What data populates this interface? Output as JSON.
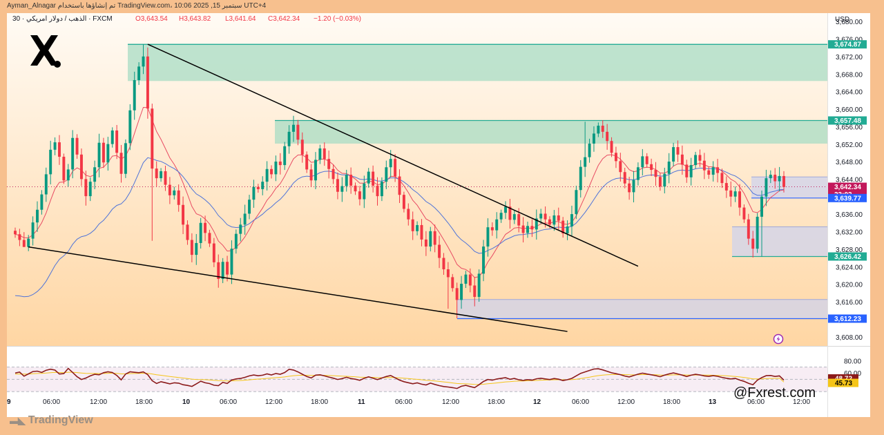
{
  "header": {
    "caption": "Ayman_Alnagar تم إنشاؤها باستخدام TradingView.com، 10:06 2025 ,15 سبتمبر UTC+4",
    "symbol": "30 · الذهب / دولار امريكي · FXCM",
    "open": "O3,643.54",
    "high": "H3,643.82",
    "low": "L3,641.64",
    "close": "C3,642.34",
    "change": "−1.20 (−0.03%)"
  },
  "brand": {
    "logo_text": "TradingView",
    "watermark": "@Fxrest.com"
  },
  "chart_data": [
    {
      "type": "candlestick",
      "symbol": "XAUUSD",
      "currency": "USD",
      "ylim": [
        3606,
        3682
      ],
      "y_ticks": [
        3608,
        3612,
        3616,
        3620,
        3624,
        3628,
        3632,
        3636,
        3640,
        3644,
        3648,
        3652,
        3656,
        3660,
        3664,
        3668,
        3672,
        3676,
        3680
      ],
      "y_tick_labels": [
        "3,608.00",
        "3,612.00",
        "3,616.00",
        "3,620.00",
        "3,624.00",
        "3,628.00",
        "3,632.00",
        "3,636.00",
        "3,640.00",
        "3,644.00",
        "3,648.00",
        "3,652.00",
        "3,656.00",
        "3,660.00",
        "3,664.00",
        "3,668.00",
        "3,672.00",
        "3,676.00",
        "3,680.00"
      ],
      "x_tick_labels": [
        "9",
        "06:00",
        "12:00",
        "18:00",
        "10",
        "06:00",
        "12:00",
        "18:00",
        "11",
        "06:00",
        "12:00",
        "18:00",
        "12",
        "06:00",
        "12:00",
        "18:00",
        "13",
        "06:00",
        "12:00"
      ],
      "price_labels": [
        {
          "text": "3,674.87",
          "value": 3674.87,
          "color": "#22ab94"
        },
        {
          "text": "3,657.48",
          "value": 3657.48,
          "color": "#22ab94"
        },
        {
          "text": "3,642.34",
          "value": 3642.34,
          "color": "#c2185b"
        },
        {
          "text": "23:02",
          "value": 3640.8,
          "color": "#c2185b"
        },
        {
          "text": "3,639.77",
          "value": 3639.77,
          "color": "#2962ff"
        },
        {
          "text": "3,626.42",
          "value": 3626.42,
          "color": "#22ab94"
        },
        {
          "text": "3,612.23",
          "value": 3612.23,
          "color": "#2962ff"
        }
      ],
      "zones": [
        {
          "kind": "supply",
          "top": 3674.87,
          "bottom": 3666.5,
          "color": "#a8dcc4"
        },
        {
          "kind": "supply",
          "top": 3657.48,
          "bottom": 3652.2,
          "color": "#a8dcc4"
        },
        {
          "kind": "range",
          "top": 3644.6,
          "bottom": 3639.77,
          "color": "#cfd3ee"
        },
        {
          "kind": "range",
          "top": 3633.2,
          "bottom": 3626.42,
          "color": "#cfd3ee"
        },
        {
          "kind": "range",
          "top": 3616.6,
          "bottom": 3612.23,
          "color": "#cfd3ee"
        }
      ],
      "trendlines": [
        {
          "from": {
            "bar": 30,
            "price": 3674.9
          },
          "to": {
            "bar": 141,
            "price": 3624.2
          }
        },
        {
          "from": {
            "bar": 3,
            "price": 3628.6
          },
          "to": {
            "bar": 125,
            "price": 3609.3
          }
        }
      ],
      "closes": [
        3631.5,
        3630.2,
        3628.6,
        3630.5,
        3634.2,
        3637.1,
        3640.6,
        3645.2,
        3650.8,
        3652.5,
        3649.2,
        3643.8,
        3646.3,
        3653.5,
        3649.7,
        3644.1,
        3640.2,
        3643.5,
        3646.8,
        3652.4,
        3647.9,
        3652.1,
        3655.2,
        3650.1,
        3645.3,
        3652.3,
        3659.8,
        3666.7,
        3669.8,
        3672.1,
        3660.2,
        3646.5,
        3644.3,
        3645.9,
        3642.8,
        3640.4,
        3641.5,
        3638.2,
        3633.7,
        3630.2,
        3626.8,
        3629.5,
        3634.1,
        3631.8,
        3629.4,
        3625.1,
        3621.3,
        3625.2,
        3622.3,
        3628.2,
        3631.6,
        3633.7,
        3636.2,
        3639.4,
        3642.3,
        3641.8,
        3643.5,
        3646.4,
        3645.2,
        3648.1,
        3647.3,
        3651.6,
        3654.9,
        3656.5,
        3653.1,
        3649.7,
        3646.3,
        3643.8,
        3648.5,
        3651.1,
        3648.7,
        3646.4,
        3644.1,
        3641.2,
        3642.5,
        3645.1,
        3642.6,
        3641.3,
        3639.5,
        3643.1,
        3645.8,
        3642.6,
        3640.2,
        3643.5,
        3646.8,
        3648.7,
        3644.7,
        3640.5,
        3637.3,
        3634.9,
        3632.2,
        3633.6,
        3630.3,
        3628.7,
        3632.2,
        3629.1,
        3626.1,
        3623.5,
        3621.7,
        3619.2,
        3616.5,
        3620.2,
        3622.3,
        3619.8,
        3617.2,
        3622.5,
        3628.7,
        3633.1,
        3632.4,
        3634.9,
        3636.4,
        3637.8,
        3634.8,
        3636.1,
        3633.5,
        3631.8,
        3633.4,
        3632.6,
        3635.1,
        3636.2,
        3634.9,
        3633.7,
        3635.8,
        3634.6,
        3631.7,
        3633.3,
        3636.1,
        3641.6,
        3646.9,
        3649.1,
        3652.2,
        3654.5,
        3656.3,
        3654.9,
        3652.8,
        3650.1,
        3648.2,
        3645.7,
        3643.1,
        3641.1,
        3643.9,
        3646.8,
        3649.3,
        3647.5,
        3646.2,
        3644.6,
        3642.4,
        3645.3,
        3648.1,
        3651.4,
        3649.7,
        3647.4,
        3644.5,
        3647.3,
        3649.6,
        3648.3,
        3646.1,
        3645.1,
        3646.8,
        3645.5,
        3643.2,
        3641.5,
        3640.1,
        3641.3,
        3637.6,
        3634.9,
        3630.5,
        3628.2,
        3635.5,
        3640.1,
        3644.3,
        3645.1,
        3643.6,
        3644.8,
        3642.3
      ]
    },
    {
      "type": "line",
      "name": "RSI",
      "ylim": [
        20,
        100
      ],
      "y_ticks": [
        80,
        60
      ],
      "y_tick_labels": [
        "80.00",
        "60.00"
      ],
      "levels": [
        70,
        50,
        30
      ],
      "value_labels": [
        {
          "text": "48.72",
          "value": 48.72,
          "color": "#8b1a1a"
        },
        {
          "text": "45.73",
          "value": 45.73,
          "color": "#f5c518"
        }
      ],
      "series": [
        {
          "values": [
            60.2,
            61.8,
            55.1,
            58.9,
            62.7,
            63.4,
            61.2,
            64.8,
            66.5,
            65.1,
            58.6,
            59.3,
            67.9,
            61.2,
            54.3,
            49.8,
            52.1,
            55.6,
            58.2,
            57.4,
            60.8,
            62.3,
            61.1,
            56.4,
            49.2,
            58.7,
            62.3,
            61.5,
            60.8,
            62.1,
            57.6,
            47.8,
            43.2,
            46.1,
            44.5,
            42.6,
            44.3,
            43.8,
            41.2,
            40.1,
            38.5,
            42.7,
            46.9,
            44.3,
            43.1,
            40.4,
            39.6,
            45.1,
            43.2,
            48.9,
            50.6,
            51.4,
            53.2,
            55.6,
            57.1,
            55.8,
            56.7,
            58.9,
            57.2,
            59.6,
            58.3,
            61.1,
            66.4,
            65.2,
            62.1,
            58.3,
            54.6,
            52.2,
            56.8,
            57.4,
            55.6,
            53.7,
            51.9,
            49.8,
            51.2,
            53.4,
            51.3,
            50.2,
            48.4,
            51.7,
            54.1,
            51.8,
            49.5,
            52.1,
            54.6,
            56.3,
            52.4,
            48.7,
            46.1,
            44.5,
            42.8,
            44.2,
            42.1,
            40.9,
            43.8,
            41.6,
            39.7,
            38.2,
            37.5,
            36.4,
            35.1,
            38.7,
            40.2,
            38.3,
            36.5,
            41.2,
            46.5,
            49.8,
            48.6,
            50.5,
            51.7,
            52.8,
            50.1,
            51.4,
            49.3,
            48.2,
            49.5,
            48.7,
            50.9,
            51.8,
            50.6,
            49.6,
            51.3,
            50.2,
            47.9,
            49.4,
            51.6,
            55.7,
            59.8,
            62.1,
            64.5,
            66.8,
            67.2,
            65.4,
            63.1,
            60.7,
            59.2,
            57.6,
            55.4,
            53.9,
            56.2,
            58.4,
            60.1,
            58.6,
            57.4,
            56.1,
            54.3,
            56.8,
            58.9,
            60.4,
            58.8,
            56.9,
            54.6,
            56.7,
            58.2,
            57.1,
            55.6,
            54.8,
            55.9,
            54.9,
            53.1,
            51.8,
            50.6,
            51.5,
            48.9,
            46.7,
            43.6,
            41.2,
            48.6,
            52.8,
            55.9,
            56.3,
            54.7,
            55.6,
            48.72
          ]
        },
        {
          "values": [
            58.4,
            58.8,
            58.6,
            58.7,
            59.1,
            59.6,
            59.8,
            60.3,
            60.9,
            61.3,
            61.1,
            60.9,
            61.6,
            61.6,
            61.0,
            60.3,
            59.8,
            59.6,
            59.5,
            59.4,
            59.6,
            59.9,
            60.1,
            59.8,
            58.9,
            58.9,
            59.3,
            59.5,
            59.7,
            60.0,
            59.8,
            58.8,
            57.5,
            56.6,
            55.6,
            54.6,
            53.8,
            53.0,
            52.1,
            51.2,
            50.3,
            49.8,
            49.6,
            49.4,
            49.1,
            48.5,
            47.9,
            47.7,
            47.3,
            47.5,
            47.8,
            48.1,
            48.6,
            49.2,
            49.9,
            50.4,
            50.9,
            51.6,
            52.1,
            52.7,
            53.2,
            53.9,
            55.0,
            55.9,
            56.5,
            56.7,
            56.6,
            56.4,
            56.5,
            56.6,
            56.5,
            56.2,
            55.9,
            55.5,
            55.1,
            54.9,
            54.5,
            54.1,
            53.6,
            53.4,
            53.4,
            53.2,
            52.8,
            52.7,
            52.8,
            53.1,
            53.0,
            52.5,
            51.9,
            51.3,
            50.5,
            50.0,
            49.3,
            48.5,
            48.1,
            47.4,
            46.6,
            45.8,
            45.0,
            44.1,
            43.2,
            42.9,
            42.7,
            42.2,
            41.6,
            41.5,
            42.0,
            42.8,
            43.4,
            44.1,
            44.9,
            45.8,
            46.3,
            46.9,
            47.2,
            47.4,
            47.7,
            47.8,
            48.2,
            48.6,
            48.8,
            49.0,
            49.3,
            49.4,
            49.3,
            49.3,
            49.6,
            50.2,
            51.3,
            52.4,
            53.6,
            54.9,
            56.0,
            56.9,
            57.4,
            57.7,
            57.9,
            57.9,
            57.7,
            57.4,
            57.3,
            57.4,
            57.7,
            57.7,
            57.7,
            57.5,
            57.1,
            56.9,
            57.0,
            57.3,
            57.4,
            57.3,
            57.1,
            57.0,
            57.1,
            57.1,
            57.0,
            56.8,
            56.6,
            56.4,
            56.1,
            55.7,
            55.1,
            54.6,
            53.9,
            53.1,
            52.0,
            50.8,
            50.6,
            50.7,
            51.2,
            51.5,
            51.6,
            51.9,
            45.73
          ]
        }
      ]
    }
  ],
  "colors": {
    "up": "#089981",
    "down": "#f23645",
    "ema_fast": "#e84b63",
    "ema_slow": "#4d72d9",
    "rsi": "#8b1a1a",
    "trendline": "#000000",
    "bg_top": "#fffaf2",
    "bg_bottom": "#ffd9a8"
  },
  "icons": {
    "logo_top_left": "x-brand-icon",
    "lightning_marker": "lightning-icon"
  }
}
